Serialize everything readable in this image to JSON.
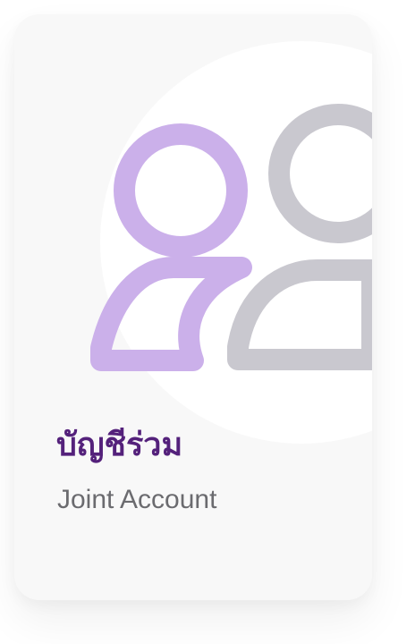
{
  "card": {
    "title_th": "บัญชีร่วม",
    "subtitle_en": "Joint Account",
    "icon": "joint-account-users-icon"
  },
  "colors": {
    "card_background": "#f8f8f8",
    "circle_background": "#ffffff",
    "primary_user": "#cbb0ea",
    "secondary_user": "#c9c8cf",
    "title": "#54217b",
    "subtitle": "#6b6b6f"
  }
}
